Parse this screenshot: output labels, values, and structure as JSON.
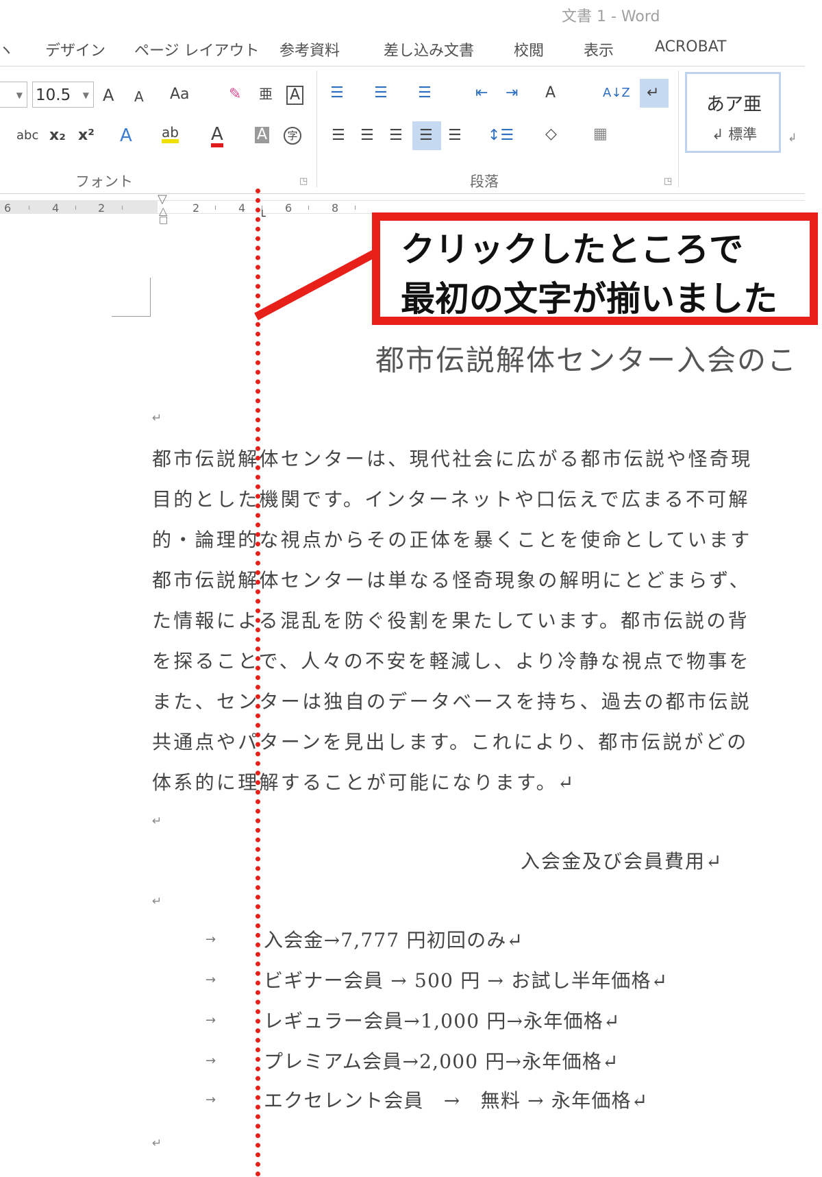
{
  "window": {
    "title": "文書 1 - Word"
  },
  "tabs": [
    {
      "label": "デザイン"
    },
    {
      "label": "ページ レイアウト"
    },
    {
      "label": "参考資料"
    },
    {
      "label": "差し込み文書"
    },
    {
      "label": "校閲"
    },
    {
      "label": "表示"
    },
    {
      "label": "ACROBAT"
    }
  ],
  "ribbon": {
    "font_size": "10.5",
    "groups": {
      "font": "フォント",
      "paragraph": "段落"
    },
    "style_gallery": {
      "sample": "あア亜",
      "style_name": "標準",
      "style_prefix": "↲"
    },
    "glyphs": {
      "grow": "A",
      "shrink": "A",
      "case": "Aa",
      "clear": "✎",
      "phonetic": "亜",
      "border_char": "A",
      "strike": "abc",
      "sub": "x₂",
      "sup": "x²",
      "effects": "A",
      "highlight": "ab",
      "font_color": "A",
      "shade_char": "A",
      "enclose": "字",
      "bullets": "☰",
      "numbering": "☰",
      "multilevel": "☰",
      "dec_indent": "⇤",
      "inc_indent": "⇥",
      "asian_layout": "A",
      "sort": "A↓Z",
      "marks": "↵",
      "align_left": "☰",
      "center": "☰",
      "align_right": "☰",
      "justify": "☰",
      "distributed": "☰",
      "spacing": "↕☰",
      "shading": "◇",
      "borders": "▦"
    }
  },
  "ruler": {
    "numbers": [
      "6",
      "4",
      "2",
      "2",
      "4",
      "6",
      "8"
    ]
  },
  "callout": {
    "line1": "クリックしたところで",
    "line2": "最初の文字が揃いました",
    "color": "#e8201a"
  },
  "document": {
    "title": "都市伝説解体センター入会のこ",
    "body_lines": [
      "都市伝説解体センターは、現代社会に広がる都市伝説や怪奇現",
      "目的とした機関です。インターネットや口伝えで広まる不可解",
      "的・論理的な視点からその正体を暴くことを使命としています",
      "都市伝説解体センターは単なる怪奇現象の解明にとどまらず、",
      "た情報による混乱を防ぐ役割を果たしています。都市伝説の背",
      "を探ることで、人々の不安を軽減し、より冷静な視点で物事を",
      "また、センターは独自のデータベースを持ち、過去の都市伝説",
      "共通点やパターンを見出します。これにより、都市伝説がどの",
      "体系的に理解することが可能になります。↵"
    ],
    "paragraph_mark": "↵",
    "section_heading": "入会金及び会員費用↵",
    "tab_arrow": "→",
    "fee_items": [
      "入会金→7,777 円初回のみ↵",
      "ビギナー会員 → 500 円 → お試し半年価格↵",
      "レギュラー会員→1,000 円→永年価格↵",
      "プレミアム会員→2,000 円→永年価格↵",
      "エクセレント会員　→　無料 → 永年価格↵"
    ]
  }
}
